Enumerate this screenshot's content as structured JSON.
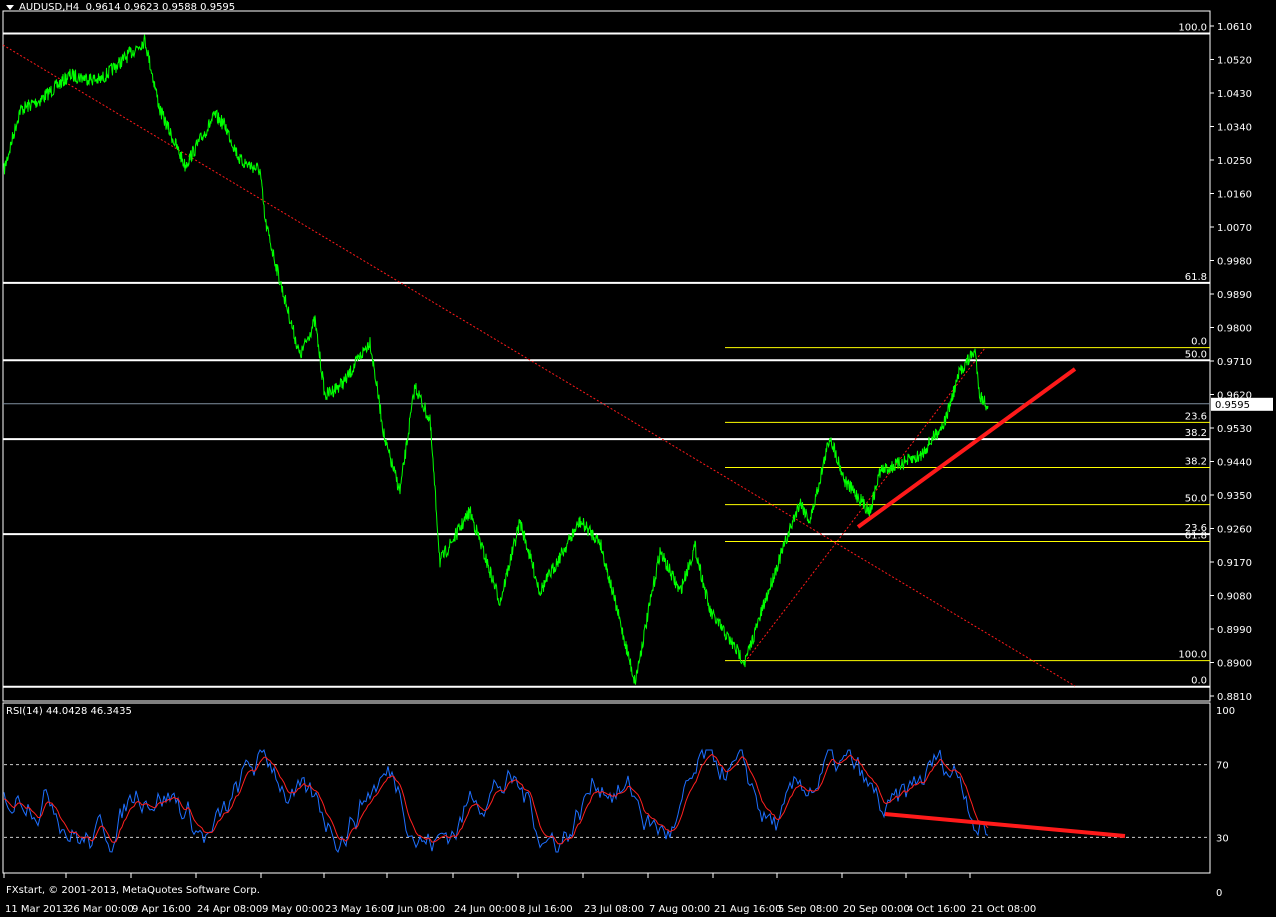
{
  "header": {
    "symbol": "AUDUSD,H4",
    "ohlc": "0.9614 0.9623 0.9588 0.9595"
  },
  "rsi_label": "RSI(14) 44.0428 46.3435",
  "copyright": "FXstart, © 2001-2013, MetaQuotes Software Corp.",
  "colors": {
    "price": "#00ff00",
    "rsi": "#1e6fff",
    "rsi_signal": "#ff2020",
    "trend": "#ff1a1a",
    "fib_major": "#ffffff",
    "fib_minor": "#ffff00",
    "bid_line": "#8090a0"
  },
  "chart_data": {
    "type": "line",
    "title": "AUDUSD,H4",
    "ylim": [
      0.881,
      1.061
    ],
    "y_ticks": [
      "1.0610",
      "1.0520",
      "1.0430",
      "1.0340",
      "1.0250",
      "1.0160",
      "1.0070",
      "0.9980",
      "0.9890",
      "0.9800",
      "0.9710",
      "0.9620",
      "0.9530",
      "0.9440",
      "0.9350",
      "0.9260",
      "0.9170",
      "0.9080",
      "0.8990",
      "0.8900",
      "0.8810"
    ],
    "current_price": "0.9595",
    "x_ticks": [
      "11 Mar 2013",
      "26 Mar 00:00",
      "9 Apr 16:00",
      "24 Apr 08:00",
      "9 May 00:00",
      "23 May 16:00",
      "7 Jun 08:00",
      "24 Jun 00:00",
      "8 Jul 16:00",
      "23 Jul 08:00",
      "7 Aug 00:00",
      "21 Aug 16:00",
      "5 Sep 08:00",
      "20 Sep 00:00",
      "4 Oct 16:00",
      "21 Oct 08:00"
    ],
    "series": [
      {
        "name": "AUDUSD close (approx)",
        "bar": [
          4,
          20,
          40,
          70,
          100,
          145,
          160,
          185,
          215,
          225,
          240,
          260,
          265,
          280,
          300,
          315,
          325,
          345,
          370,
          385,
          400,
          415,
          430,
          440,
          470,
          500,
          520,
          540,
          580,
          600,
          615,
          635,
          660,
          680,
          695,
          710,
          745,
          775,
          800,
          810,
          830,
          845,
          870,
          880,
          920,
          945,
          960,
          975,
          980,
          988
        ],
        "values": [
          1.0222,
          1.0384,
          1.0411,
          1.0478,
          1.0464,
          1.0572,
          1.0384,
          1.0235,
          1.037,
          1.0343,
          1.0249,
          1.0222,
          1.0087,
          0.9925,
          0.9723,
          0.9818,
          0.9616,
          0.9656,
          0.9764,
          0.9494,
          0.936,
          0.9643,
          0.9548,
          0.9171,
          0.9306,
          0.9063,
          0.9279,
          0.909,
          0.9279,
          0.9225,
          0.9063,
          0.8847,
          0.9198,
          0.909,
          0.9211,
          0.9036,
          0.8901,
          0.9144,
          0.9333,
          0.9279,
          0.9508,
          0.9387,
          0.9306,
          0.9414,
          0.9454,
          0.9548,
          0.9683,
          0.9737,
          0.9616,
          0.9589
        ]
      }
    ],
    "fib_major": [
      {
        "label": "100.0",
        "price": 1.059
      },
      {
        "label": "61.8",
        "price": 0.992
      },
      {
        "label": "50.0",
        "price": 0.9712
      },
      {
        "label": "38.2",
        "price": 0.95
      },
      {
        "label": "23.6",
        "price": 0.9245
      },
      {
        "label": "0.0",
        "price": 0.8835
      }
    ],
    "fib_minor": [
      {
        "label": "0.0",
        "price": 0.9746
      },
      {
        "label": "23.6",
        "price": 0.9545
      },
      {
        "label": "38.2",
        "price": 0.9424
      },
      {
        "label": "50.0",
        "price": 0.9324
      },
      {
        "label": "61.8",
        "price": 0.9225
      },
      {
        "label": "100.0",
        "price": 0.8905
      }
    ],
    "rsi": {
      "ylim": [
        0,
        100
      ],
      "levels": [
        30,
        70
      ],
      "ticks": [
        "100",
        "70",
        "30",
        "0"
      ]
    }
  }
}
